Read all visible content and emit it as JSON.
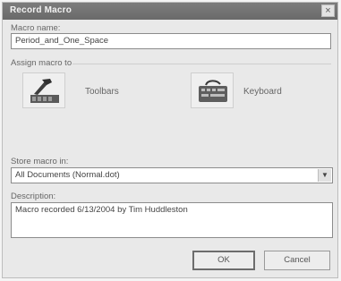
{
  "window": {
    "title": "Record Macro",
    "close_glyph": "×"
  },
  "macro_name": {
    "label": "Macro name:",
    "value": "Period_and_One_Space"
  },
  "assign": {
    "label": "Assign macro to",
    "toolbars_label": "Toolbars",
    "keyboard_label": "Keyboard",
    "toolbars_icon": "toolbar-hammer-icon",
    "keyboard_icon": "keyboard-icon"
  },
  "store": {
    "label": "Store macro in:",
    "value": "All Documents (Normal.dot)"
  },
  "description": {
    "label": "Description:",
    "value": "Macro recorded 6/13/2004 by Tim Huddleston"
  },
  "buttons": {
    "ok": "OK",
    "cancel": "Cancel"
  }
}
